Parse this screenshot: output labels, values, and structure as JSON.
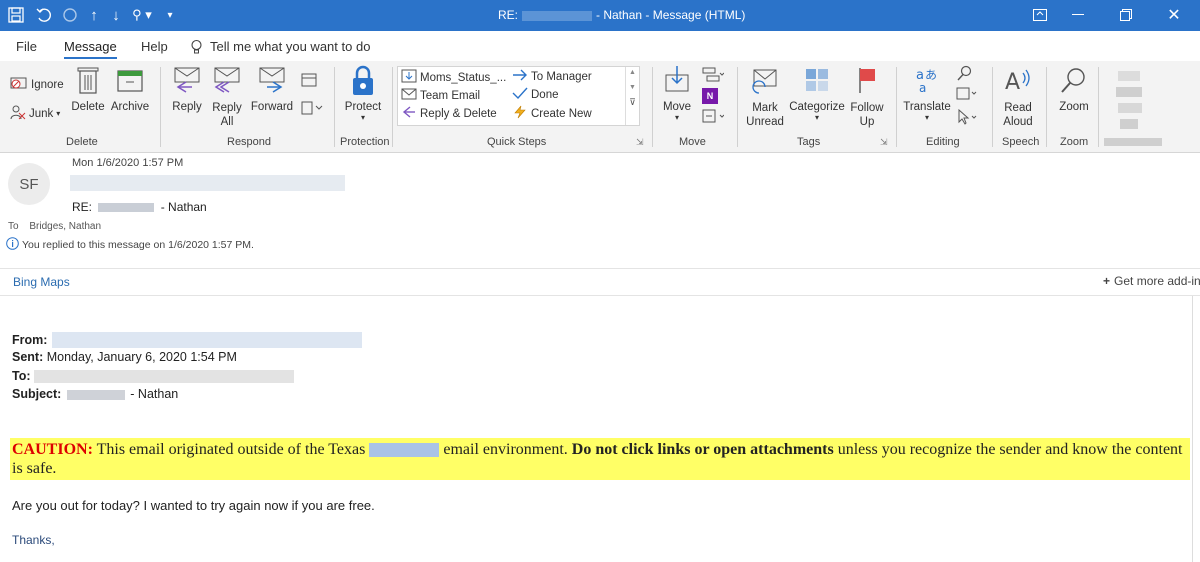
{
  "window": {
    "title_prefix": "RE:",
    "title_suffix": "- Nathan  -  Message (HTML)"
  },
  "menubar": {
    "items": [
      "File",
      "Message",
      "Help"
    ],
    "search": "Tell me what you want to do"
  },
  "ribbon": {
    "delete": {
      "ignore": "Ignore",
      "junk": "Junk",
      "delete": "Delete",
      "archive": "Archive",
      "group": "Delete"
    },
    "respond": {
      "reply": "Reply",
      "reply_all": "Reply All",
      "forward": "Forward",
      "group": "Respond"
    },
    "protection": {
      "protect": "Protect",
      "group": "Protection"
    },
    "quick_steps": {
      "items": [
        "Moms_Status_...",
        "Team Email",
        "Reply & Delete",
        "To Manager",
        "Done",
        "Create New"
      ],
      "group": "Quick Steps"
    },
    "move": {
      "move": "Move",
      "group": "Move"
    },
    "tags": {
      "mark_unread": "Mark Unread",
      "categorize": "Categorize",
      "follow_up": "Follow Up",
      "group": "Tags"
    },
    "editing": {
      "translate": "Translate",
      "group": "Editing"
    },
    "speech": {
      "read_aloud": "Read Aloud",
      "group": "Speech"
    },
    "zoom": {
      "zoom": "Zoom",
      "group": "Zoom"
    }
  },
  "message": {
    "avatar_initials": "SF",
    "date": "Mon 1/6/2020 1:57 PM",
    "subject_prefix": "RE:",
    "subject_suffix": "- Nathan",
    "to_label": "To",
    "to_value": "Bridges, Nathan",
    "info": "You replied to this message on 1/6/2020 1:57 PM."
  },
  "addins": {
    "bing_maps": "Bing Maps",
    "get_more": "Get more add-ins"
  },
  "body": {
    "from_label": "From:",
    "sent_label": "Sent:",
    "sent_value": "Monday, January 6, 2020 1:54 PM",
    "to_label": "To:",
    "subject_label": "Subject:",
    "subject_suffix": "- Nathan",
    "caution_label": "CAUTION:",
    "caution_1": "This email originated outside of the Texas",
    "caution_2": "email environment.",
    "caution_bold": "Do not click links or open attachments",
    "caution_3": "unless you recognize the sender and know the content is safe.",
    "line1": "Are you out for today? I wanted to try again now if you are free.",
    "signoff": "Thanks,"
  },
  "colors": {
    "titlebar": "#2b73c9",
    "caution_bg": "#ffff66",
    "caution_red": "#dd0000",
    "link": "#2b6cb0"
  }
}
